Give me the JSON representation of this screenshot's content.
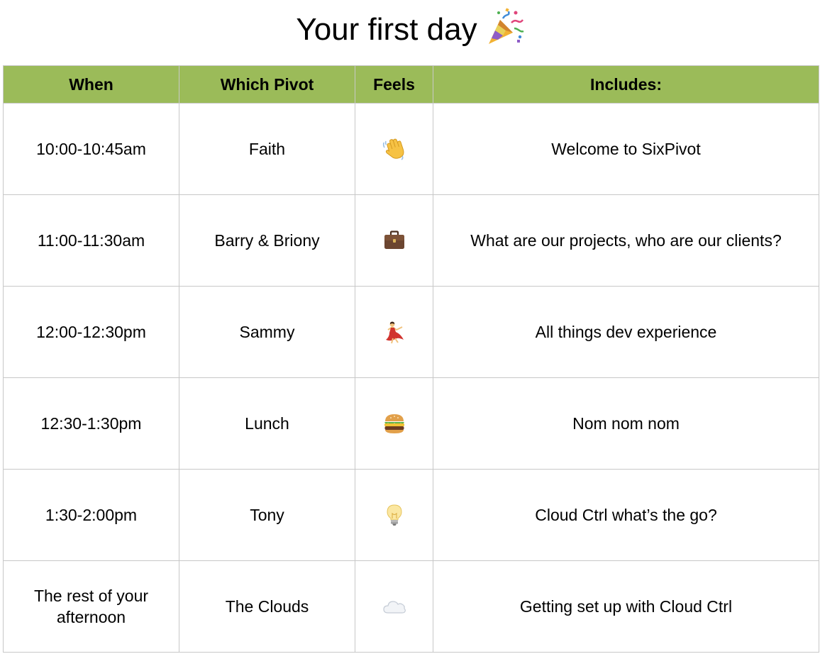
{
  "title": "Your first day",
  "title_icon": "party-popper-icon",
  "header_color": "#9bbb59",
  "table": {
    "headers": [
      "When",
      "Which Pivot",
      "Feels",
      "Includes:"
    ],
    "rows": [
      {
        "when": "10:00-10:45am",
        "pivot": "Faith",
        "feels_icon": "waving-hand-icon",
        "includes": "Welcome to SixPivot"
      },
      {
        "when": "11:00-11:30am",
        "pivot": "Barry & Briony",
        "feels_icon": "briefcase-icon",
        "includes": "What are our projects, who are our clients?"
      },
      {
        "when": "12:00-12:30pm",
        "pivot": "Sammy",
        "feels_icon": "dancer-icon",
        "includes": "All things dev experience"
      },
      {
        "when": "12:30-1:30pm",
        "pivot": "Lunch",
        "feels_icon": "hamburger-icon",
        "includes": "Nom nom nom"
      },
      {
        "when": "1:30-2:00pm",
        "pivot": "Tony",
        "feels_icon": "light-bulb-icon",
        "includes": "Cloud Ctrl what’s the go?"
      },
      {
        "when": "The rest of your afternoon",
        "pivot": "The Clouds",
        "feels_icon": "cloud-icon",
        "includes": "Getting set up with Cloud Ctrl"
      }
    ]
  }
}
